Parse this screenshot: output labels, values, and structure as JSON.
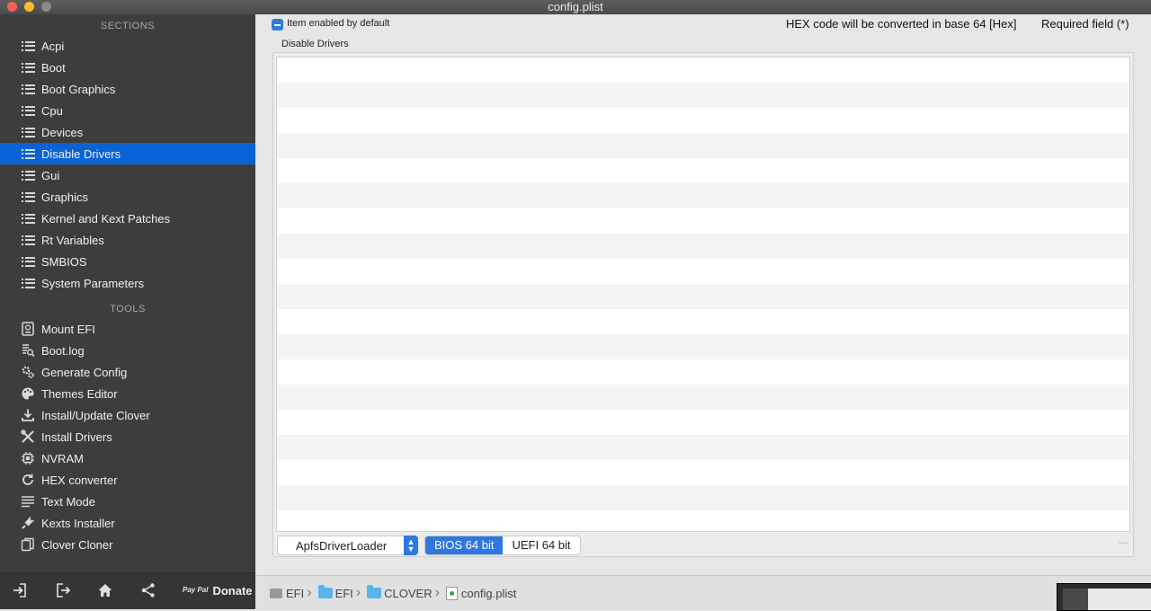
{
  "window": {
    "title": "config.plist"
  },
  "sidebar": {
    "sections_header": "SECTIONS",
    "sections": [
      {
        "label": "Acpi",
        "icon": "list-icon"
      },
      {
        "label": "Boot",
        "icon": "list-icon"
      },
      {
        "label": "Boot Graphics",
        "icon": "list-icon"
      },
      {
        "label": "Cpu",
        "icon": "list-icon"
      },
      {
        "label": "Devices",
        "icon": "list-icon"
      },
      {
        "label": "Disable Drivers",
        "icon": "list-icon",
        "selected": true
      },
      {
        "label": "Gui",
        "icon": "list-icon"
      },
      {
        "label": "Graphics",
        "icon": "list-icon"
      },
      {
        "label": "Kernel and Kext Patches",
        "icon": "list-icon"
      },
      {
        "label": "Rt Variables",
        "icon": "list-icon"
      },
      {
        "label": "SMBIOS",
        "icon": "list-icon"
      },
      {
        "label": "System Parameters",
        "icon": "list-icon"
      }
    ],
    "tools_header": "TOOLS",
    "tools": [
      {
        "label": "Mount EFI",
        "icon": "disk-icon"
      },
      {
        "label": "Boot.log",
        "icon": "log-search-icon"
      },
      {
        "label": "Generate Config",
        "icon": "gears-icon"
      },
      {
        "label": "Themes Editor",
        "icon": "palette-icon"
      },
      {
        "label": "Install/Update Clover",
        "icon": "download-icon"
      },
      {
        "label": "Install Drivers",
        "icon": "tools-icon"
      },
      {
        "label": "NVRAM",
        "icon": "chip-icon"
      },
      {
        "label": "HEX converter",
        "icon": "refresh-icon"
      },
      {
        "label": "Text Mode",
        "icon": "text-lines-icon"
      },
      {
        "label": "Kexts Installer",
        "icon": "plug-icon"
      },
      {
        "label": "Clover Cloner",
        "icon": "copy-icon"
      }
    ],
    "bottom": {
      "donate_logo": "Pay Pal",
      "donate_label": "Donate"
    }
  },
  "main": {
    "checkbox_label": "Item enabled by default",
    "hex_note": "HEX code will be converted in base 64 [Hex]",
    "required_note": "Required field (*)",
    "panel_title": "Disable Drivers",
    "table_row_count": 19,
    "dropdown_value": "ApfsDriverLoader",
    "segments": [
      {
        "label": "BIOS 64 bit",
        "active": true
      },
      {
        "label": "UEFI 64 bit",
        "active": false
      }
    ],
    "dash": "---"
  },
  "pathbar": {
    "crumbs": [
      "EFI",
      "EFI",
      "CLOVER",
      "config.plist"
    ],
    "separator": "›"
  },
  "colors": {
    "accent": "#2f78e0",
    "selection": "#0a63d6",
    "sidebar_bg": "#3d3d3d"
  }
}
